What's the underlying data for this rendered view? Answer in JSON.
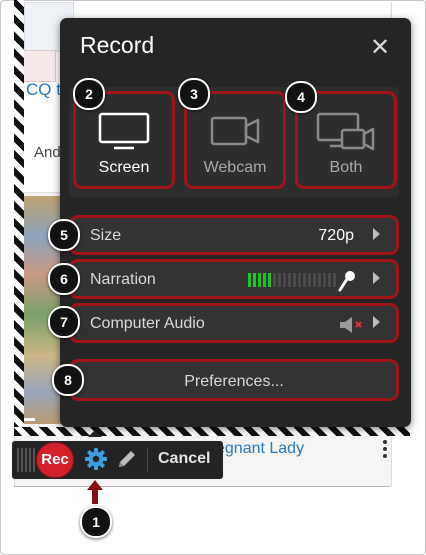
{
  "panel": {
    "title": "Record",
    "close_icon": "close-icon",
    "modes": [
      {
        "label": "Screen",
        "icon": "monitor-icon",
        "active": true
      },
      {
        "label": "Webcam",
        "icon": "webcam-icon",
        "active": false
      },
      {
        "label": "Both",
        "icon": "screen-and-webcam-icon",
        "active": false
      }
    ],
    "size": {
      "label": "Size",
      "value": "720p"
    },
    "narration": {
      "label": "Narration",
      "meter_level": 0.28,
      "icon": "microphone-icon"
    },
    "computer_audio": {
      "label": "Computer Audio",
      "icon": "speaker-muted-icon"
    },
    "preferences": {
      "label": "Preferences..."
    }
  },
  "toolbar": {
    "rec_label": "Rec",
    "cancel_label": "Cancel",
    "settings_icon": "gear-icon",
    "pencil_icon": "pencil-icon"
  },
  "background": {
    "link_text": "CQ t",
    "body_text": "And",
    "bottom_link": "egnant Lady"
  },
  "badges": {
    "b1": "1",
    "b2": "2",
    "b3": "3",
    "b4": "4",
    "b5": "5",
    "b6": "6",
    "b7": "7",
    "b8": "8"
  },
  "colors": {
    "panel_bg": "#252525",
    "highlight_border": "#a0141a",
    "rec_red": "#d4202a",
    "meter_green": "#22c322",
    "gear_blue": "#3b9ee0"
  }
}
